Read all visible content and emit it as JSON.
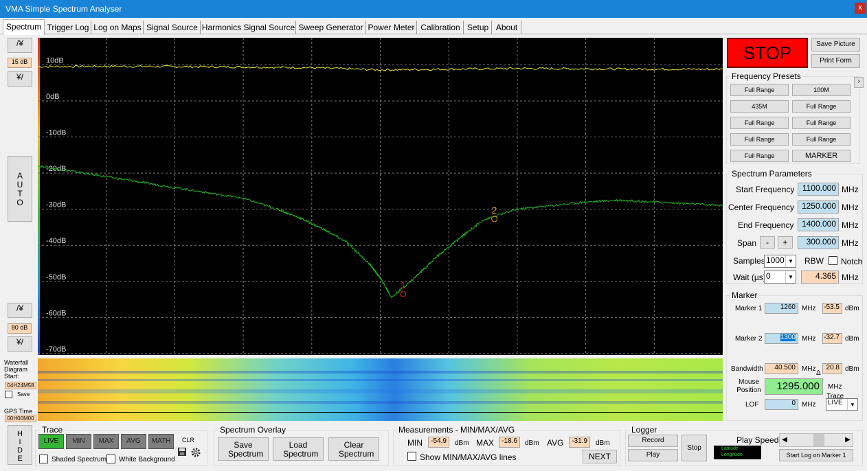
{
  "window": {
    "title": "VMA Simple Spectrum Analyser",
    "close_label": "x"
  },
  "tabs": [
    "Spectrum",
    "Trigger Log",
    "Log on Maps",
    "Signal Source",
    "Harmonics Signal Source",
    "Sweep Generator",
    "Power Meter",
    "Calibration",
    "Setup",
    "About"
  ],
  "left": {
    "ref_up": "/¥",
    "ref_value": "15 dB",
    "ref_down": "¥/",
    "auto": "AUTO",
    "range_up": "/¥",
    "range_value": "80 dB",
    "range_down": "¥/",
    "waterfall_label": "Waterfall Diagram Start:",
    "waterfall_start": "04H24M58",
    "save_label": "Save",
    "gps_label": "GPS Time",
    "gps_value": "00H00M00",
    "hide": "HIDE"
  },
  "chart_data": {
    "type": "line",
    "x_range_mhz": [
      1100,
      1400
    ],
    "ylim": [
      -70,
      15
    ],
    "y_ticks": [
      "10dB",
      "0dB",
      "-10dB",
      "-20dB",
      "-30dB",
      "-40dB",
      "-50dB",
      "-60dB",
      "-70dB"
    ],
    "y_tick_values": [
      10,
      0,
      -10,
      -20,
      -30,
      -40,
      -50,
      -60,
      -70
    ],
    "grid": true,
    "series": [
      {
        "color": "#e8e820",
        "x": [
          1100,
          1130,
          1160,
          1190,
          1220,
          1250,
          1280,
          1310,
          1340,
          1370,
          1400
        ],
        "y": [
          9.5,
          9.6,
          9.5,
          9.4,
          9.2,
          8.6,
          8.8,
          9.0,
          8.9,
          8.8,
          8.8
        ]
      },
      {
        "color": "#22b822",
        "x": [
          1100,
          1115,
          1130,
          1145,
          1160,
          1175,
          1190,
          1205,
          1215,
          1225,
          1235,
          1245,
          1250,
          1255,
          1265,
          1275,
          1285,
          1295,
          1310,
          1325,
          1340,
          1355,
          1370,
          1385,
          1400
        ],
        "y": [
          -18,
          -19.5,
          -21,
          -22.5,
          -24,
          -25.5,
          -27,
          -30,
          -32.5,
          -35.5,
          -39,
          -45,
          -49,
          -54.5,
          -49,
          -43,
          -38,
          -33,
          -30,
          -29,
          -28,
          -27.5,
          -28,
          -28.5,
          -29
        ]
      }
    ],
    "markers": [
      {
        "label": "1",
        "x": 1260,
        "y": -53.5,
        "color": "#d02020"
      },
      {
        "label": "2",
        "x": 1300,
        "y": -32.7,
        "color": "#e0a020"
      }
    ]
  },
  "right": {
    "stop": "STOP",
    "save_picture": "Save Picture",
    "print_form": "Print Form",
    "presets_title": "Frequency Presets",
    "presets": [
      "Full Range",
      "100M",
      "435M",
      "Full Range",
      "Full Range",
      "Full Range",
      "Full Range",
      "Full Range",
      "Full Range",
      "MARKER"
    ],
    "params_title": "Spectrum Parameters",
    "start_label": "Start Frequency",
    "start_value": "1100.000",
    "center_label": "Center Frequency",
    "center_value": "1250.000",
    "end_label": "End Frequency",
    "end_value": "1400.000",
    "span_label": "Span",
    "span_minus": "-",
    "span_plus": "+",
    "span_value": "300.000",
    "mhz": "MHz",
    "samples_label": "Samples",
    "samples_value": "1000",
    "rbw_label": "RBW",
    "notch_label": "Notch",
    "wait_label": "Wait (µs)",
    "wait_value": "0",
    "rbw_value": "4.365",
    "marker_title": "Marker",
    "m1_label": "Marker 1",
    "m1_freq": "1260",
    "m1_dbm": "-53.5",
    "m2_label": "Marker 2",
    "m2_freq": "1300",
    "m2_dbm": "-32.7",
    "dbm": "dBm",
    "bw_label": "Bandwidth",
    "bw_value": "40.500",
    "bw_db": "20.8",
    "delta": "Δ",
    "mouse_label": "Mouse Position",
    "mouse_value": "1295.000",
    "trace_label": "Trace",
    "lof_label": "LOF",
    "lof_value": "0",
    "trace_value": "LIVE"
  },
  "bottom": {
    "trace_title": "Trace",
    "trace_buttons": [
      "LIVE",
      "MIN",
      "MAX",
      "AVG",
      "MATH"
    ],
    "clr": "CLR",
    "shaded": "Shaded Spectrum",
    "white_bg": "White Background",
    "overlay_title": "Spectrum Overlay",
    "save_spectrum": "Save Spectrum",
    "load_spectrum": "Load Spectrum",
    "clear_spectrum": "Clear Spectrum",
    "meas_title": "Measurements - MIN/MAX/AVG",
    "min_label": "MIN",
    "min_value": "-54.9",
    "max_label": "MAX",
    "max_value": "-18.6",
    "avg_label": "AVG",
    "avg_value": "-31.9",
    "dbm": "dBm",
    "show_lines": "Show MIN/MAX/AVG lines",
    "next": "NEXT",
    "logger_title": "Logger",
    "record": "Record",
    "play": "Play",
    "stop": "Stop",
    "play_speed": "Play Speed",
    "latitude": "Latitude",
    "longitude": "Longitude",
    "start_log": "Start Log on Marker 1"
  }
}
